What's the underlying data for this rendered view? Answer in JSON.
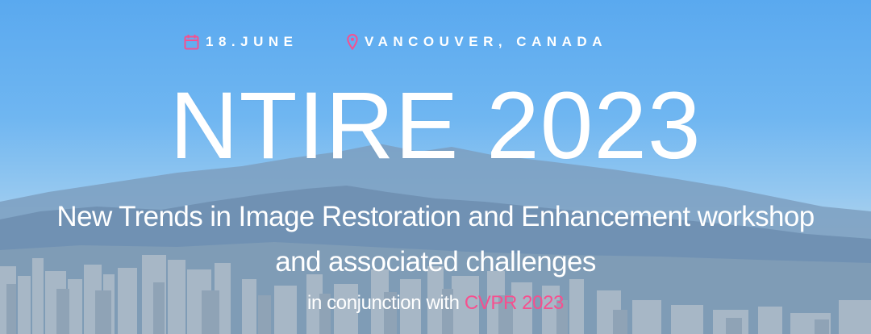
{
  "hero": {
    "date_icon": "calendar-icon",
    "date": "18.JUNE",
    "location_icon": "map-pin-icon",
    "location": "VANCOUVER, CANADA",
    "title": "NTIRE 2023",
    "subtitle_line1": "New Trends in Image Restoration and Enhancement workshop",
    "subtitle_line2": "and associated challenges",
    "conjunction_prefix": "in conjunction with",
    "conjunction_link": "CVPR 2023"
  },
  "colors": {
    "accent": "#f6508f",
    "text": "#ffffff",
    "sky_top": "#5aa9ef",
    "mountains": "#6e94b6"
  }
}
